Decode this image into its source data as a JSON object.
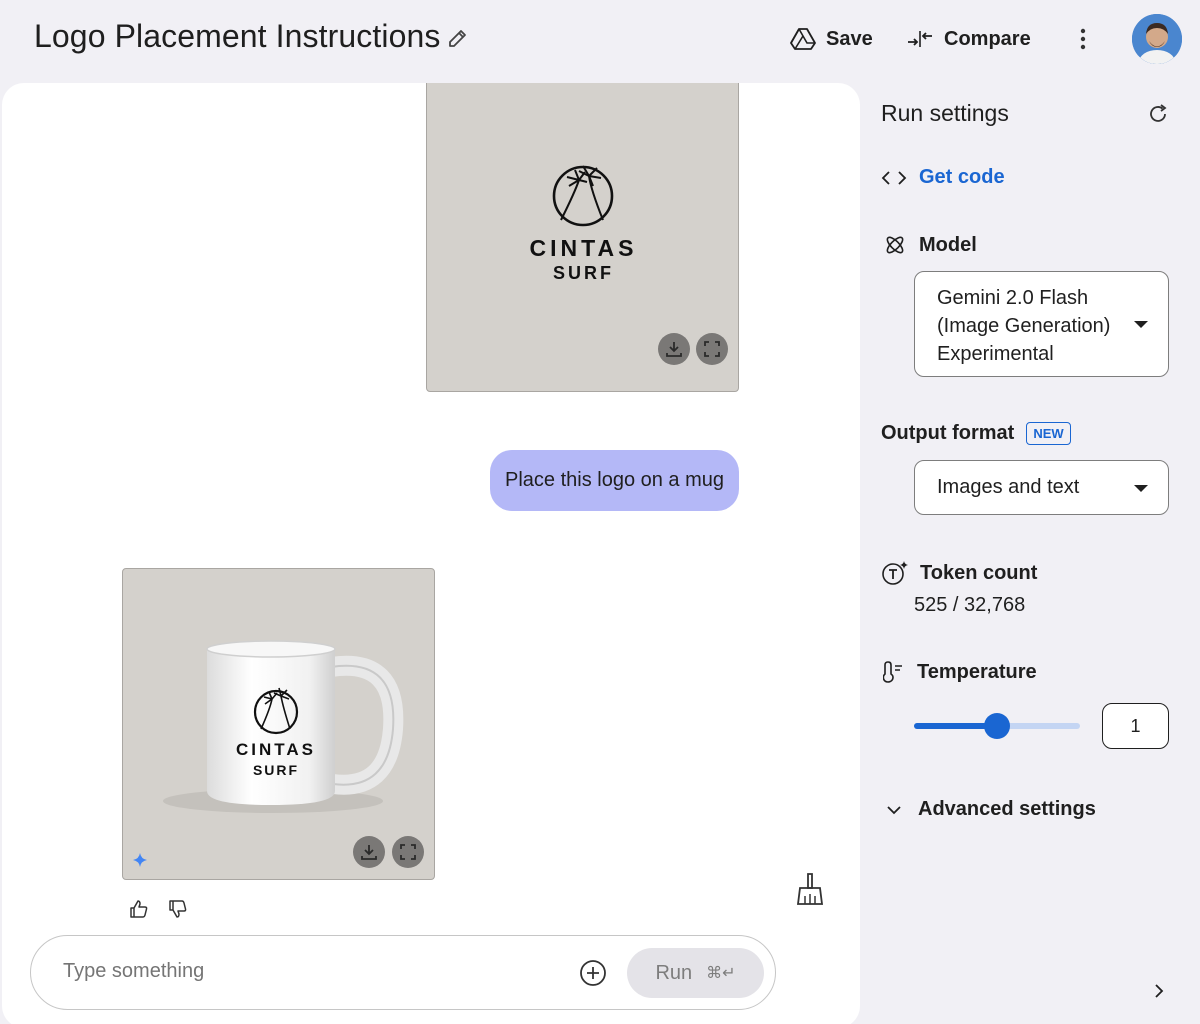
{
  "header": {
    "title": "Logo Placement Instructions",
    "save_label": "Save",
    "compare_label": "Compare"
  },
  "chat": {
    "logo_text_main": "CINTAS",
    "logo_text_sub": "SURF",
    "user_message": "Place this logo on a mug",
    "composer_placeholder": "Type something",
    "run_label": "Run",
    "run_shortcut": "⌘↵"
  },
  "run_settings": {
    "title": "Run settings",
    "get_code_label": "Get code",
    "model_label": "Model",
    "model_value": [
      "Gemini 2.0 Flash",
      "(Image Generation)",
      "Experimental"
    ],
    "output_format_label": "Output format",
    "new_badge": "NEW",
    "output_format_value": "Images and text",
    "token_count_label": "Token count",
    "token_count_value": "525 / 32,768",
    "temperature_label": "Temperature",
    "temperature_value": "1",
    "temperature_fraction": 0.5,
    "advanced_label": "Advanced settings"
  },
  "colors": {
    "accent": "#1a66d2",
    "user_bubble": "#b4b8f7",
    "panel_bg": "#f1f0f5",
    "image_bg": "#d4d1cc"
  }
}
